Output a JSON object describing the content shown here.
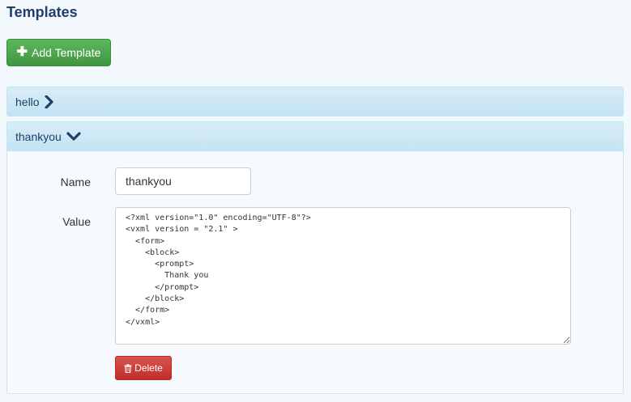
{
  "page": {
    "title": "Templates"
  },
  "toolbar": {
    "add_label": "Add Template",
    "add_icon": "plus-icon"
  },
  "templates": [
    {
      "name": "hello",
      "expanded": false,
      "toggle_icon": "chevron-right-icon"
    },
    {
      "name": "thankyou",
      "expanded": true,
      "toggle_icon": "chevron-down-icon"
    }
  ],
  "editor": {
    "name_label": "Name",
    "name_value": "thankyou",
    "value_label": "Value",
    "value_text": "<?xml version=\"1.0\" encoding=\"UTF-8\"?>\n<vxml version = \"2.1\" >\n  <form>\n    <block>\n      <prompt>\n        Thank you\n      </prompt>\n    </block>\n  </form>\n</vxml>",
    "delete_label": "Delete",
    "delete_icon": "trash-icon"
  },
  "colors": {
    "title": "#1d3f6a",
    "add_button": "#4cae4c",
    "panel_heading": "#d9edf7",
    "delete_button": "#d9534f"
  }
}
